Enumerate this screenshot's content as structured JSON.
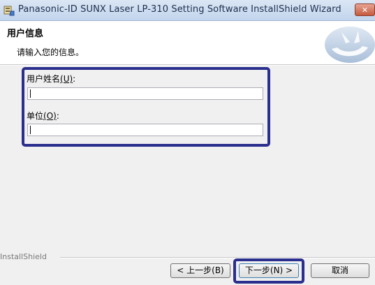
{
  "window": {
    "title": "Panasonic-ID SUNX Laser LP-310 Setting Software InstallShield Wizard",
    "close_symbol": "✕"
  },
  "header": {
    "title": "用户信息",
    "subtitle": "请输入您的信息。"
  },
  "form": {
    "user_name_label": "用户姓名",
    "user_name_accel": "(U)",
    "user_name_suffix": ":",
    "user_name_value": "",
    "organization_label": "单位",
    "organization_accel": "(O)",
    "organization_suffix": ":",
    "organization_value": ""
  },
  "footer": {
    "brand": "InstallShield",
    "back_label": "< 上一步(B)",
    "next_label": "下一步(N) >",
    "cancel_label": "取消"
  },
  "colors": {
    "highlight": "#2a2e8c"
  }
}
